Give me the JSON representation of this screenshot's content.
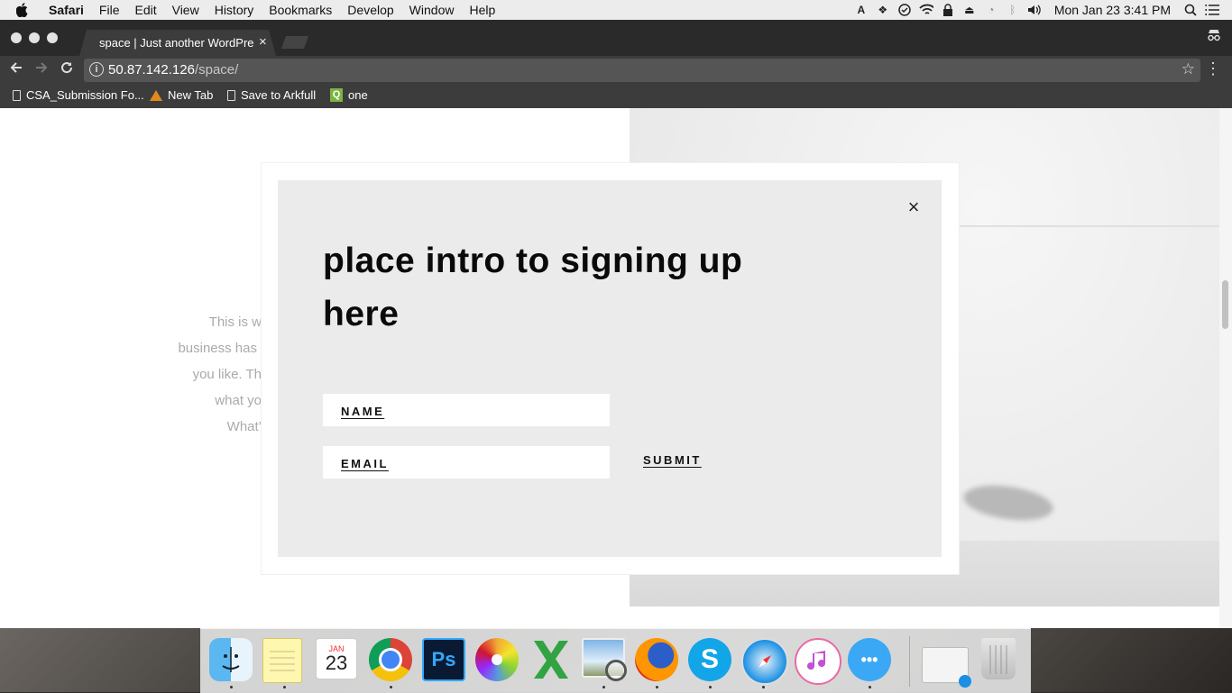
{
  "menubar": {
    "apple_icon": "apple-icon",
    "items": [
      "Safari",
      "File",
      "Edit",
      "View",
      "History",
      "Bookmarks",
      "Develop",
      "Window",
      "Help"
    ],
    "status_icons": [
      "adobe-icon",
      "dropbox-icon",
      "task-icon",
      "wifi-icon",
      "lock-icon",
      "eject-icon",
      "time-machine-icon",
      "bluetooth-icon",
      "volume-icon"
    ],
    "clock": "Mon Jan 23  3:41 PM",
    "search_icon": "spotlight-icon",
    "list_icon": "notification-list-icon"
  },
  "browser": {
    "tab_title": "space | Just another WordPress",
    "tab_close": "×",
    "url_host": "50.87.142.126",
    "url_path": "/space/",
    "bookmarks": [
      "CSA_Submission Fo...",
      "New Tab",
      "Save to Arkfull",
      "one"
    ]
  },
  "page": {
    "background_text": [
      "This is w",
      "business has",
      "you like. Th",
      "what yo",
      "What’"
    ]
  },
  "modal": {
    "close": "×",
    "heading": "place intro to signing up here",
    "name_label": "NAME",
    "email_label": "EMAIL",
    "submit_label": "SUBMIT"
  },
  "dock": {
    "calendar_month": "JAN",
    "calendar_day": "23",
    "ps_label": "Ps",
    "apps": [
      "finder-icon",
      "notes-icon",
      "calendar-icon",
      "chrome-icon",
      "photoshop-icon",
      "photos-icon",
      "excel-icon",
      "preview-icon",
      "firefox-icon",
      "skype-icon",
      "safari-icon",
      "itunes-icon",
      "messages-icon",
      "downloads-icon",
      "trash-icon"
    ]
  }
}
